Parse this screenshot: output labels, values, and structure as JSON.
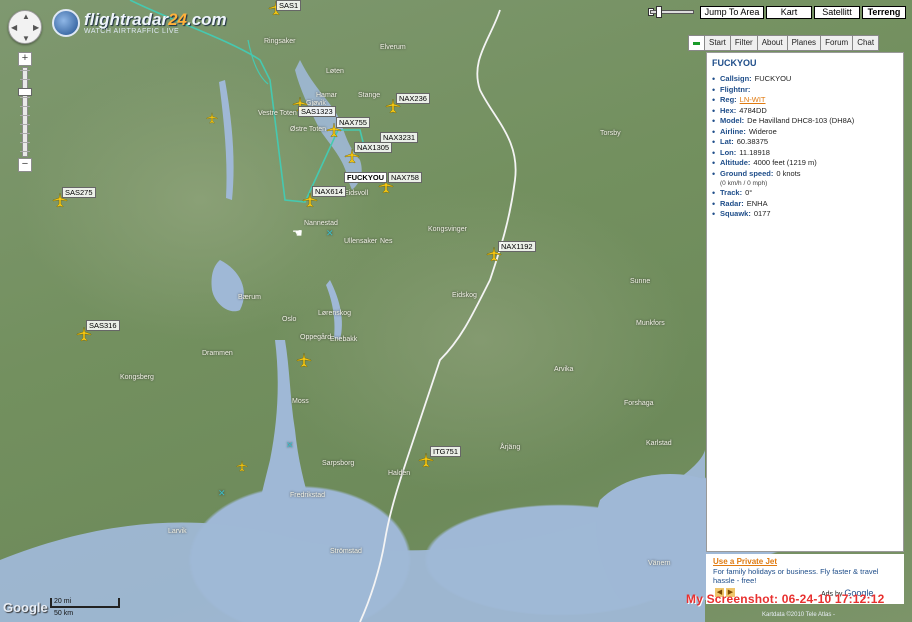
{
  "logo": {
    "main_text": "flightradar",
    "main_num": "24",
    "main_suffix": ".com",
    "tagline": "WATCH AIRTRAFFIC LIVE"
  },
  "map_controls": {
    "zoom_in": "+",
    "zoom_out": "−",
    "jump_to_area": "Jump To Area",
    "map_types": [
      "Kart",
      "Satellitt",
      "Terreng"
    ],
    "active_map_type": "Terreng"
  },
  "tabs": [
    "Start",
    "Filter",
    "About",
    "Planes",
    "Forum",
    "Chat"
  ],
  "selected_flight": {
    "title": "FUCKYOU",
    "fields": [
      {
        "label": "Callsign:",
        "value": "FUCKYOU"
      },
      {
        "label": "Flightnr:",
        "value": ""
      },
      {
        "label": "Reg:",
        "value": "LN-WIT",
        "link": true
      },
      {
        "label": "Hex:",
        "value": "4784DD"
      },
      {
        "label": "Model:",
        "value": "De Havilland DHC8-103 (DH8A)"
      },
      {
        "label": "Airline:",
        "value": "Wideroe"
      },
      {
        "label": "Lat:",
        "value": "60.38375"
      },
      {
        "label": "Lon:",
        "value": "11.18918"
      },
      {
        "label": "Altitude:",
        "value": "4000 feet (1219 m)"
      },
      {
        "label": "Ground speed:",
        "value": "0 knots"
      },
      {
        "label": "Track:",
        "value": "0°"
      },
      {
        "label": "Radar:",
        "value": "ENHA"
      },
      {
        "label": "Squawk:",
        "value": "0177"
      }
    ],
    "speed_note": "(0 km/h / 0 mph)"
  },
  "aircraft": [
    {
      "callsign": "SAS1323"
    },
    {
      "callsign": "NAX236"
    },
    {
      "callsign": "NAX755"
    },
    {
      "callsign": "NAX3231"
    },
    {
      "callsign": "NAX1305"
    },
    {
      "callsign": "FUCKYOU"
    },
    {
      "callsign": "NAX758"
    },
    {
      "callsign": "NAX614"
    },
    {
      "callsign": "SAS275"
    },
    {
      "callsign": "NAX1192"
    },
    {
      "callsign": "SAS316"
    },
    {
      "callsign": "ITG751"
    },
    {
      "callsign": "SAS1"
    }
  ],
  "places": [
    "Ringsaker",
    "Elverum",
    "Løten",
    "Stange",
    "Hamar",
    "Gjøvik",
    "Vestre Toten",
    "Østre Toten",
    "Eidsvoll",
    "Nannestad",
    "Ullensaker",
    "Nes",
    "Kongsvinger",
    "Eidskog",
    "Bærum",
    "Oslo",
    "Lørenskog",
    "Enebakk",
    "Oppegård",
    "Drammen",
    "Kongsberg",
    "Moss",
    "Sarpsborg",
    "Fredrikstad",
    "Halden",
    "Larvik",
    "Karlstad",
    "Arvika",
    "Torsby",
    "Sunne",
    "Vänern",
    "Strömstad",
    "Munkfors",
    "Forshaga",
    "Årjäng"
  ],
  "ad": {
    "title": "Use a Private Jet",
    "text": "For family holidays or business. Fly faster & travel hassle - free!",
    "footer": "Ads by",
    "brand": "Google"
  },
  "map_footer": {
    "google": "Google",
    "scale_top": "20 mi",
    "scale_bottom": "50 km",
    "copyright": "Kartdata ©2010 Tele Atlas -"
  },
  "screenshot_stamp": "My Screenshot: 06-24-10 17:12:12",
  "colors": {
    "track": "#46c9b0",
    "plane": "#f2c514",
    "border": "#f4f4f4",
    "panel_link": "#1f4e8a",
    "accent": "#e07a10"
  }
}
